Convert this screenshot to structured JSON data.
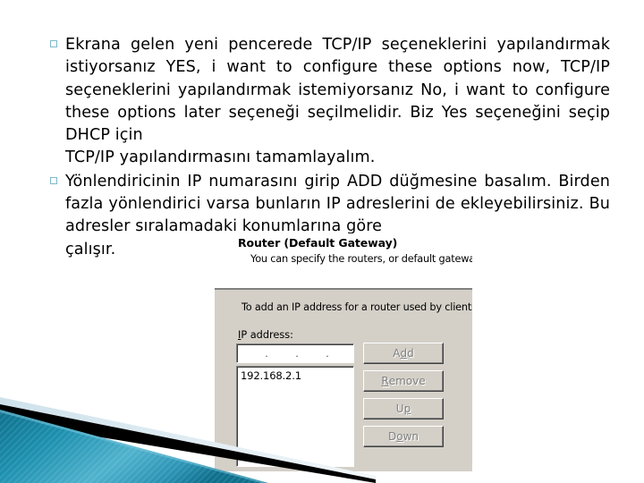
{
  "slide": {
    "bullets": [
      {
        "marker": "hollow-square-bullet",
        "text": "Ekrana gelen yeni pencerede TCP/IP seçeneklerini yapılandırmak istiyorsanız YES, i want to configure these options now, TCP/IP seçeneklerini yapılandırmak istemiyorsanız No, i want to configure these options later seçeneği seçilmelidir. Biz Yes seçeneğini seçip DHCP için",
        "last_line": "TCP/IP yapılandırmasını tamamlayalım."
      },
      {
        "marker": "hollow-square-bullet",
        "text": "Yönlendiricinin IP numarasını girip ADD düğmesine basalım. Birden fazla yönlendirici varsa bunların IP adreslerini de ekleyebilirsiniz. Bu adresler sıralamadaki konumlarına göre",
        "last_line": "çalışır."
      }
    ]
  },
  "dialog": {
    "title": "Router (Default Gateway)",
    "subtitle": "You can specify the routers, or default gateways, to",
    "description": "To add an IP address for a router used by clients, e",
    "ip_label_pre": "I",
    "ip_label_mnemonic": "P",
    "ip_label_post": " address:",
    "ip_input": {
      "value": "",
      "separators": [
        ".",
        ".",
        "."
      ]
    },
    "ip_list": [
      "192.168.2.1"
    ],
    "buttons": [
      {
        "name": "add",
        "pre": "A",
        "mnemonic": "d",
        "post": "d"
      },
      {
        "name": "remove",
        "pre": "",
        "mnemonic": "R",
        "post": "emove"
      },
      {
        "name": "up",
        "pre": "U",
        "mnemonic": "p",
        "post": ""
      },
      {
        "name": "down",
        "pre": "D",
        "mnemonic": "o",
        "post": "wn"
      }
    ]
  },
  "theme": {
    "bullet_color": "#7fb8c9",
    "dialog_face": "#d4d0c8",
    "corner_teal_dark": "#0f7d9e",
    "corner_teal_light": "#56b4d0",
    "corner_pale": "#dce9f0",
    "corner_black": "#000000",
    "text_color": "#000000",
    "background": "#ffffff"
  }
}
